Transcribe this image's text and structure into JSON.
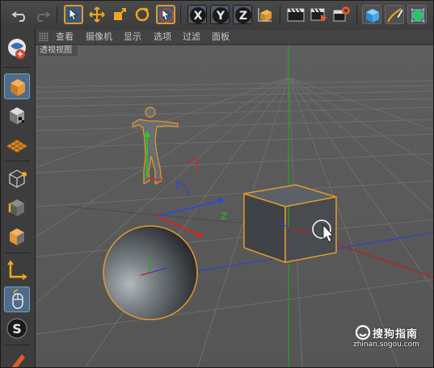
{
  "viewport_menu": {
    "items": [
      "查看",
      "摄像机",
      "显示",
      "选项",
      "过滤",
      "面板"
    ]
  },
  "viewport": {
    "label": "透视视图"
  },
  "watermark": {
    "text": "搜狗指南",
    "url": "zhinan.sogou.com"
  },
  "colors": {
    "accent_orange": "#e49a2a",
    "axis_x": "#e02020",
    "axis_y": "#20d020",
    "axis_z": "#2040e0",
    "viewport_bg": "#5c5c5c",
    "grid_line": "#6c6c6c"
  },
  "icons": {
    "toolbar": [
      "undo-icon",
      "redo-icon",
      "select-icon",
      "move-icon",
      "scale-icon",
      "rotate-icon",
      "live-select-icon",
      "x-axis-icon",
      "y-axis-icon",
      "z-axis-icon",
      "coordinate-system-icon",
      "render-view-icon",
      "render-picture-viewer-icon",
      "render-settings-icon",
      "cube-primitive-icon",
      "pen-spline-icon",
      "subdivision-icon"
    ],
    "left": [
      "make-editable-icon",
      "model-mode-icon",
      "texture-mode-icon",
      "workplane-icon",
      "points-mode-icon",
      "edges-mode-icon",
      "polygons-mode-icon",
      "axis-mode-icon",
      "tweak-mode-icon",
      "snap-icon",
      "brush-icon"
    ]
  }
}
